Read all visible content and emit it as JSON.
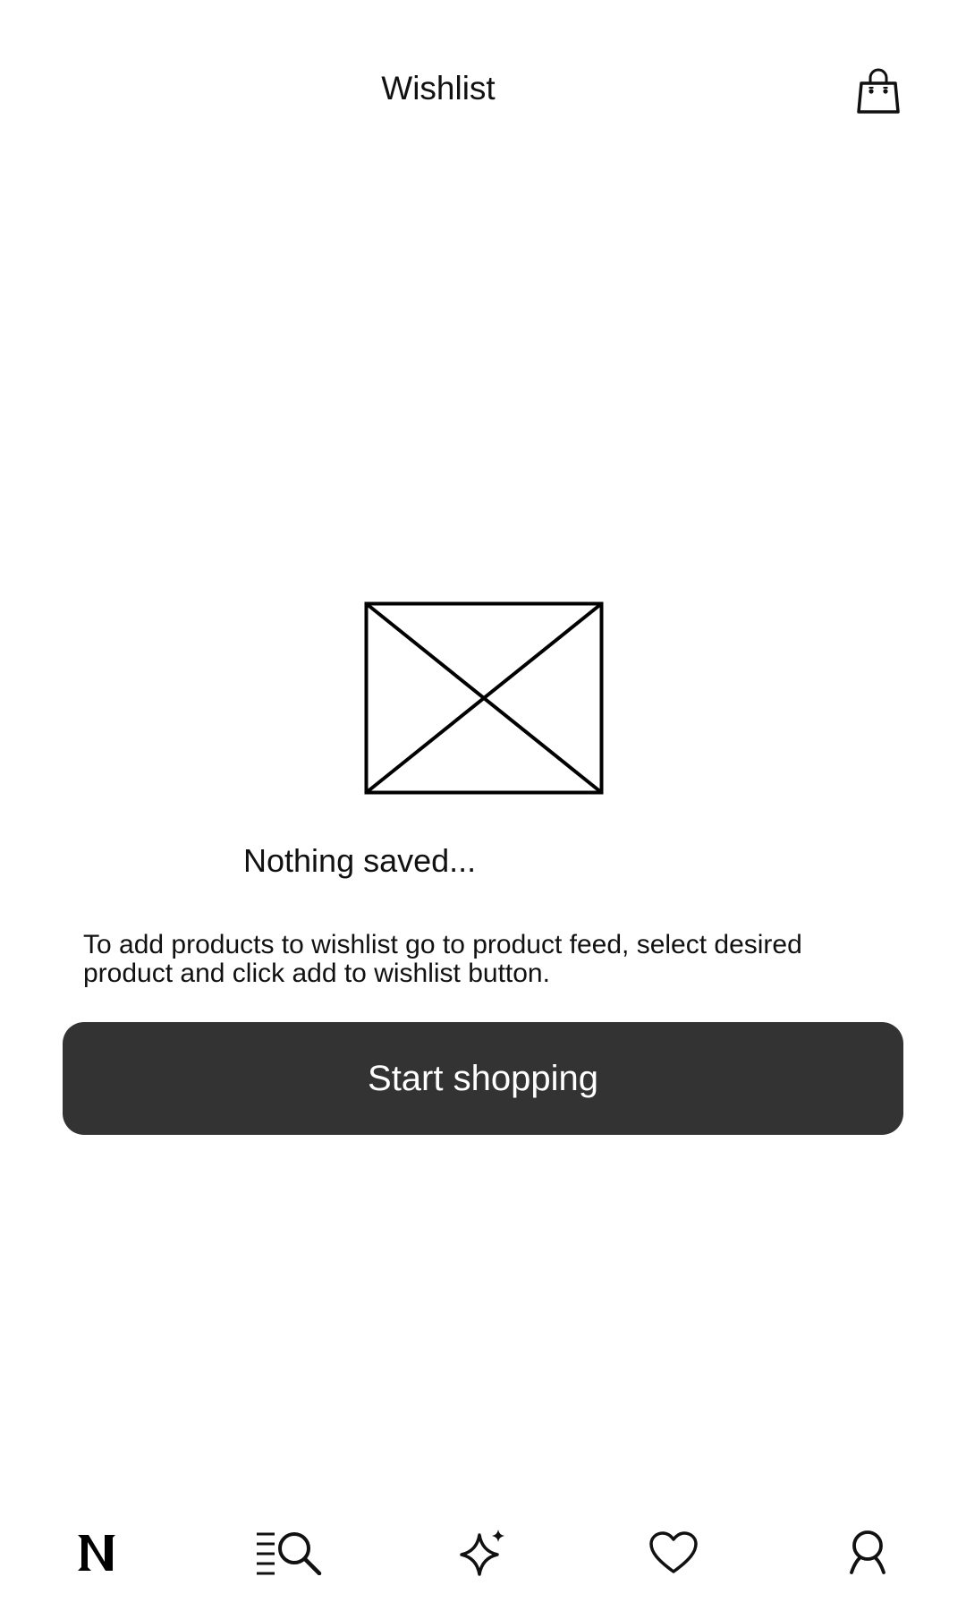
{
  "header": {
    "title": "Wishlist",
    "bag_icon": "shopping-bag-icon"
  },
  "empty_state": {
    "image_icon": "image-placeholder-icon",
    "title": "Nothing saved...",
    "description": "To add products to wishlist go to product feed, select desired product and click add to wishlist button.",
    "cta_label": "Start shopping"
  },
  "bottom_nav": {
    "items": [
      {
        "id": "home",
        "icon": "brand-logo-n-icon"
      },
      {
        "id": "search",
        "icon": "list-search-icon"
      },
      {
        "id": "discover",
        "icon": "sparkle-icon"
      },
      {
        "id": "wishlist",
        "icon": "heart-icon"
      },
      {
        "id": "profile",
        "icon": "user-icon"
      }
    ]
  },
  "colors": {
    "button_bg": "#333333",
    "button_text": "#ffffff",
    "text": "#111111",
    "background": "#ffffff"
  }
}
